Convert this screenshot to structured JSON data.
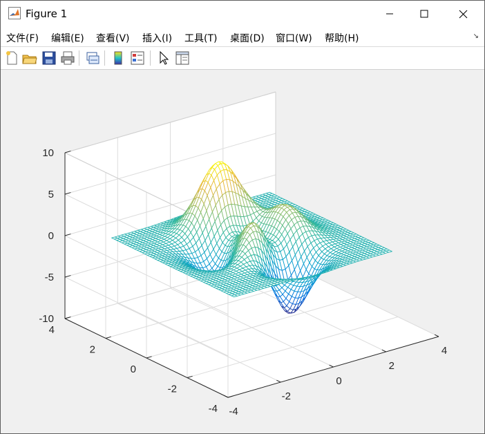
{
  "window": {
    "title": "Figure 1"
  },
  "menu": {
    "items": [
      {
        "label": "文件(F)",
        "key": "F",
        "name": "menu-file"
      },
      {
        "label": "编辑(E)",
        "key": "E",
        "name": "menu-edit"
      },
      {
        "label": "查看(V)",
        "key": "V",
        "name": "menu-view"
      },
      {
        "label": "插入(I)",
        "key": "I",
        "name": "menu-insert"
      },
      {
        "label": "工具(T)",
        "key": "T",
        "name": "menu-tools"
      },
      {
        "label": "桌面(D)",
        "key": "D",
        "name": "menu-desktop"
      },
      {
        "label": "窗口(W)",
        "key": "W",
        "name": "menu-window"
      },
      {
        "label": "帮助(H)",
        "key": "H",
        "name": "menu-help"
      }
    ]
  },
  "toolbar": {
    "icons": [
      "new-figure-icon",
      "open-file-icon",
      "save-icon",
      "print-icon",
      "link-plot-icon",
      "colorbar-icon",
      "legend-icon",
      "pointer-icon",
      "property-inspector-icon"
    ]
  },
  "colors": {
    "window_bg": "#f0f0f0",
    "surface_high": "#f9e21a",
    "surface_mid": "#21c4c9",
    "surface_low": "#3b2fa8"
  },
  "chart_data": {
    "type": "mesh",
    "function": "peaks",
    "x": {
      "range": [
        -3,
        3
      ],
      "ticks": [
        "-4",
        "-2",
        "0",
        "2",
        "4"
      ],
      "lim": [
        -4,
        4
      ]
    },
    "y": {
      "range": [
        -3,
        3
      ],
      "ticks": [
        "-4",
        "-2",
        "0",
        "2",
        "4"
      ],
      "lim": [
        -4,
        4
      ]
    },
    "z": {
      "ticks": [
        "-10",
        "-5",
        "0",
        "5",
        "10"
      ],
      "lim": [
        -10,
        10
      ],
      "max": 8.1,
      "min": -6.55
    },
    "grid": true,
    "colormap": "parula",
    "view": {
      "azimuth": -37.5,
      "elevation": 30
    }
  }
}
